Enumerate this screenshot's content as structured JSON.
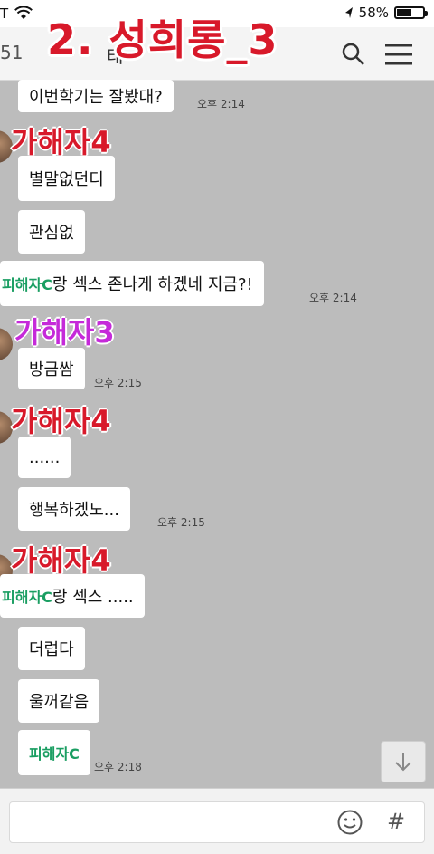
{
  "status_bar": {
    "carrier": "T",
    "battery_percent": "58%",
    "battery_level": 0.58
  },
  "header": {
    "count_partial": "51",
    "name_partial": "태",
    "search_icon": "search-icon",
    "menu_icon": "menu-icon"
  },
  "overlay_title": "2. 성희롱_3",
  "messages": [
    {
      "text": "이번학기는 잘봤대?",
      "time": "오후 2:14"
    },
    {
      "text": "별말없던디"
    },
    {
      "text": "관심없"
    },
    {
      "highlight": "피해자C",
      "text": "랑 섹스 존나게 하겠네 지금?!",
      "time": "오후 2:14"
    },
    {
      "text": "방금쌈",
      "time": "오후 2:15"
    },
    {
      "text": "......"
    },
    {
      "text": "행복하겠노...",
      "time": "오후 2:15"
    },
    {
      "highlight": "피해자C",
      "text": "랑 섹스 ....."
    },
    {
      "text": "더럽다"
    },
    {
      "text": "울꺼같음"
    },
    {
      "highlight": "피해자C",
      "text": "",
      "time": "오후 2:18"
    }
  ],
  "labels": {
    "perp4": "가해자4",
    "perp3": "가해자3"
  },
  "colors": {
    "label_red": "#d8192a",
    "label_purple": "#c52ad9",
    "victim_green": "#1a9e62",
    "chat_bg": "#bcbcbc"
  },
  "input": {
    "placeholder": "",
    "emoji_icon": "smiley-icon",
    "hash_label": "#"
  }
}
